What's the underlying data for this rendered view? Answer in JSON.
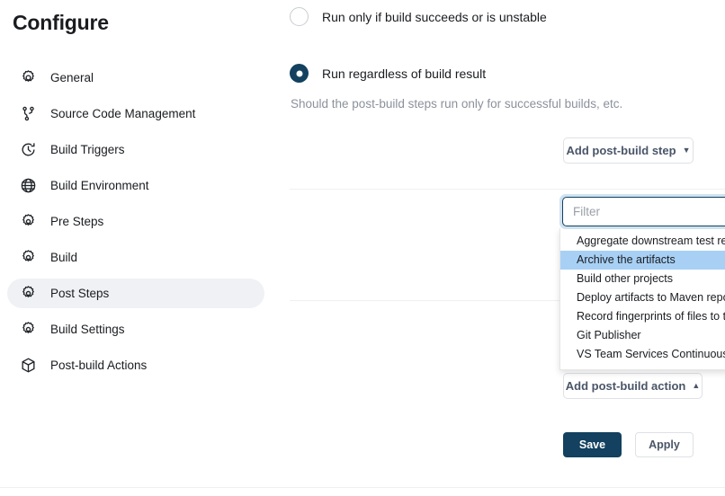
{
  "sidebar": {
    "title": "Configure",
    "items": [
      {
        "label": "General",
        "icon": "gear-icon",
        "active": false
      },
      {
        "label": "Source Code Management",
        "icon": "git-branch-icon",
        "active": false
      },
      {
        "label": "Build Triggers",
        "icon": "clock-icon",
        "active": false
      },
      {
        "label": "Build Environment",
        "icon": "globe-icon",
        "active": false
      },
      {
        "label": "Pre Steps",
        "icon": "gear-icon",
        "active": false
      },
      {
        "label": "Build",
        "icon": "gear-icon",
        "active": false
      },
      {
        "label": "Post Steps",
        "icon": "gear-icon",
        "active": true
      },
      {
        "label": "Build Settings",
        "icon": "gear-icon",
        "active": false
      },
      {
        "label": "Post-build Actions",
        "icon": "package-icon",
        "active": false
      }
    ]
  },
  "main": {
    "radios": [
      {
        "label": "Run only if build succeeds or is unstable",
        "checked": false
      },
      {
        "label": "Run regardless of build result",
        "checked": true
      }
    ],
    "help_text": "Should the post-build steps run only for successful builds, etc.",
    "add_post_build_step_label": "Add post-build step",
    "add_post_build_step_caret": "▼",
    "add_post_build_action_label": "Add post-build action",
    "add_post_build_action_caret": "▲",
    "dropdown": {
      "filter_placeholder": "Filter",
      "filter_value": "",
      "items": [
        {
          "label": "Aggregate downstream test results",
          "selected": false
        },
        {
          "label": "Archive the artifacts",
          "selected": true
        },
        {
          "label": "Build other projects",
          "selected": false
        },
        {
          "label": "Deploy artifacts to Maven repository",
          "selected": false
        },
        {
          "label": "Record fingerprints of files to track usage",
          "selected": false
        },
        {
          "label": "Git Publisher",
          "selected": false
        },
        {
          "label": "VS Team Services Continuous Deployment",
          "selected": false
        }
      ]
    },
    "save_label": "Save",
    "apply_label": "Apply"
  },
  "colors": {
    "accent": "#13415f",
    "selection": "#a8d0f5",
    "sidebar_active_bg": "#f0f1f4",
    "muted_text": "#8b919b"
  }
}
